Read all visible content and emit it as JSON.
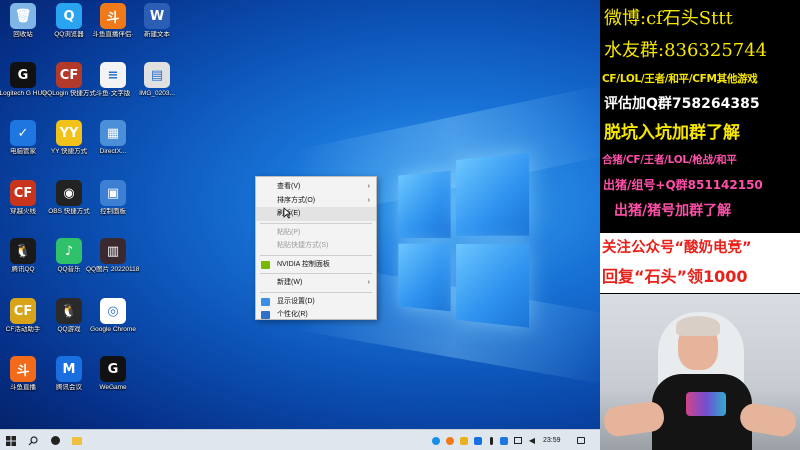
{
  "desktop": {
    "icons": [
      {
        "label": "回收站",
        "icon": "recycle-bin-icon",
        "color": "#7fb6e6",
        "glyph": "🗑"
      },
      {
        "label": "QQ浏览器",
        "icon": "qq-browser-icon",
        "color": "#2aa3f0",
        "glyph": "Q"
      },
      {
        "label": "斗鱼直播伴侣·",
        "icon": "douyu-icon",
        "color": "#f07a1a",
        "glyph": "斗"
      },
      {
        "label": "新建文本",
        "icon": "word-doc-icon",
        "color": "#2b5fb5",
        "glyph": "W"
      },
      {
        "label": "Logitech G HUB",
        "icon": "logitech-icon",
        "color": "#111111",
        "glyph": "G"
      },
      {
        "label": "QQLogin 快捷方式",
        "icon": "qqlogin-icon",
        "color": "#b33a2a",
        "glyph": "CF"
      },
      {
        "label": "斗鱼·文字版",
        "icon": "text-file-icon",
        "color": "#f4f4f4",
        "glyph": "≡"
      },
      {
        "label": "IMG_0203...",
        "icon": "image-file-icon",
        "color": "#e0e0e0",
        "glyph": "▤"
      },
      {
        "label": "电脑管家",
        "icon": "pc-manager-icon",
        "color": "#1e77e0",
        "glyph": "✓"
      },
      {
        "label": "YY 快捷方式",
        "icon": "yy-icon",
        "color": "#f2c21b",
        "glyph": "YY"
      },
      {
        "label": "DirectX...",
        "icon": "directx-icon",
        "color": "#4a8fd8",
        "glyph": "▦"
      },
      {
        "label": "穿越火线",
        "icon": "crossfire-icon",
        "color": "#c8341c",
        "glyph": "CF"
      },
      {
        "label": "OBS 快捷方式",
        "icon": "obs-icon",
        "color": "#222222",
        "glyph": "◉"
      },
      {
        "label": "控制面板",
        "icon": "control-panel-icon",
        "color": "#3d7fd3",
        "glyph": "▣"
      },
      {
        "label": "腾讯QQ",
        "icon": "qq-icon",
        "color": "#1a1a1a",
        "glyph": "🐧"
      },
      {
        "label": "QQ音乐",
        "icon": "qq-music-icon",
        "color": "#30c26a",
        "glyph": "♪"
      },
      {
        "label": "QQ图片 20220118...",
        "icon": "photo-file-icon",
        "color": "#3a2a30",
        "glyph": "▥"
      },
      {
        "label": "CF活动助手",
        "icon": "cf-helper-icon",
        "color": "#d8a41a",
        "glyph": "CF"
      },
      {
        "label": "QQ游戏",
        "icon": "qq-game-icon",
        "color": "#2a2a2a",
        "glyph": "🐧"
      },
      {
        "label": "Google Chrome",
        "icon": "chrome-icon",
        "color": "#ffffff",
        "glyph": "◎"
      },
      {
        "label": "斗鱼直播",
        "icon": "douyu-live-icon",
        "color": "#f26b1b",
        "glyph": "斗"
      },
      {
        "label": "腾讯会议",
        "icon": "tencent-meeting-icon",
        "color": "#1a6fe0",
        "glyph": "M"
      },
      {
        "label": "WeGame",
        "icon": "wegame-icon",
        "color": "#111111",
        "glyph": "G"
      }
    ]
  },
  "context_menu": {
    "items": [
      {
        "label": "查看(V)",
        "submenu": true,
        "disabled": false,
        "icon": ""
      },
      {
        "label": "排序方式(O)",
        "submenu": true,
        "disabled": false,
        "icon": ""
      },
      {
        "label": "刷新(E)",
        "submenu": false,
        "disabled": false,
        "icon": ""
      },
      {
        "label": "粘贴(P)",
        "submenu": false,
        "disabled": true,
        "icon": ""
      },
      {
        "label": "粘贴快捷方式(S)",
        "submenu": false,
        "disabled": true,
        "icon": ""
      },
      {
        "label": "NVIDIA 控制面板",
        "submenu": false,
        "disabled": false,
        "icon": "nvidia-icon"
      },
      {
        "label": "新建(W)",
        "submenu": true,
        "disabled": false,
        "icon": ""
      },
      {
        "label": "显示设置(D)",
        "submenu": false,
        "disabled": false,
        "icon": "display-settings-icon"
      },
      {
        "label": "个性化(R)",
        "submenu": false,
        "disabled": false,
        "icon": "personalize-icon"
      }
    ]
  },
  "taskbar": {
    "clock": "23:59",
    "apps": [
      "start-icon",
      "search-icon",
      "obs-taskbar-icon",
      "folder-icon"
    ],
    "tray": [
      "qq-tray-icon",
      "douyu-tray-icon",
      "wegame-tray-icon",
      "chat-tray-icon",
      "mic-icon",
      "shield-tray-icon",
      "network-icon",
      "volume-icon"
    ]
  },
  "panel": {
    "weibo": "微博:cf石头Sttt",
    "fans_group": "水友群:836325744",
    "games_line": "CF/LOL/王者/和平/CFM其他游戏",
    "evaluate": "评估加Q群758264385",
    "escape": "脱坑入坑加群了解",
    "hezhu": "合猪/CF/王者/LOL/枪战/和平",
    "chuzhu": "出猪/组号+Q群851142150",
    "chuzhu2": "出猪/猪号加群了解",
    "follow": "关注公众号“酸奶电竞”",
    "reply": "回复“石头”领1000",
    "colors": {
      "yellow": "#f7e600",
      "pink": "#ff4fa8",
      "white": "#ffffff",
      "red": "#e8211b"
    }
  }
}
